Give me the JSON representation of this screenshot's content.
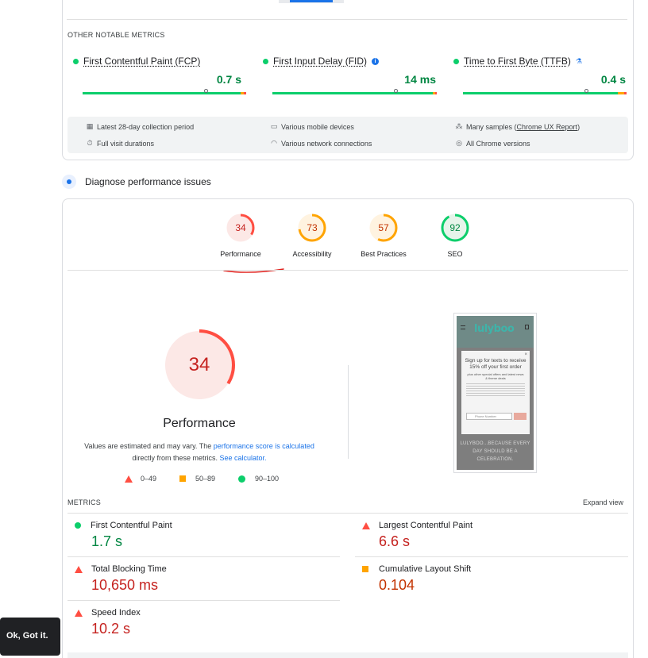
{
  "field_data": {
    "section_label": "OTHER NOTABLE METRICS",
    "metrics": [
      {
        "label": "First Contentful Paint (FCP)",
        "value": "0.7 s",
        "status": "good",
        "icon": "",
        "marker_fraction": 0.75
      },
      {
        "label": "First Input Delay (FID)",
        "value": "14 ms",
        "status": "good",
        "icon": "info-icon",
        "marker_fraction": 0.75
      },
      {
        "label": "Time to First Byte (TTFB)",
        "value": "0.4 s",
        "status": "good",
        "icon": "flask-icon",
        "marker_fraction": 0.75
      }
    ],
    "info": [
      {
        "icon": "calendar-icon",
        "text": "Latest 28-day collection period"
      },
      {
        "icon": "devices-icon",
        "text": "Various mobile devices"
      },
      {
        "icon": "users-icon",
        "text": "Many samples (",
        "link": "Chrome UX Report",
        "suffix": ")"
      },
      {
        "icon": "timer-icon",
        "text": "Full visit durations"
      },
      {
        "icon": "wifi-icon",
        "text": "Various network connections"
      },
      {
        "icon": "chrome-icon",
        "text": "All Chrome versions"
      }
    ]
  },
  "diagnose": {
    "title": "Diagnose performance issues"
  },
  "category_tabs": [
    {
      "label": "Performance",
      "score": 34,
      "color": "#ff4e42",
      "text_color": "#c5221f",
      "bg": "#fce8e6"
    },
    {
      "label": "Accessibility",
      "score": 73,
      "color": "#ffa400",
      "text_color": "#c33300",
      "bg": "#fff3e0"
    },
    {
      "label": "Best Practices",
      "score": 57,
      "color": "#ffa400",
      "text_color": "#c33300",
      "bg": "#fff3e0"
    },
    {
      "label": "SEO",
      "score": 92,
      "color": "#0cce6b",
      "text_color": "#018642",
      "bg": "#e6f4ea"
    }
  ],
  "main_score": {
    "score": "34",
    "label": "Performance",
    "estimate_text": "Values are estimated and may vary. The ",
    "estimate_link": "performance score is calculated",
    "estimate_text2": " directly from these metrics. ",
    "calc_link": "See calculator."
  },
  "legend": {
    "fail": "0–49",
    "average": "50–89",
    "pass": "90–100"
  },
  "screenshot": {
    "logo": "lulyboo",
    "popup_title": "Sign up for texts to receive 15% off your first order",
    "popup_sub": "plus other special offers and latest news & theme deals",
    "field_placeholder": "Phone Number",
    "bottom_text": "LULYBOO...BECAUSE EVERY DAY SHOULD BE A CELEBRATION."
  },
  "metrics_section": {
    "label": "METRICS",
    "expand": "Expand view",
    "items": [
      {
        "name": "First Contentful Paint",
        "value": "1.7 s",
        "status": "pass"
      },
      {
        "name": "Largest Contentful Paint",
        "value": "6.6 s",
        "status": "fail"
      },
      {
        "name": "Total Blocking Time",
        "value": "10,650 ms",
        "status": "fail"
      },
      {
        "name": "Cumulative Layout Shift",
        "value": "0.104",
        "status": "average"
      },
      {
        "name": "Speed Index",
        "value": "10.2 s",
        "status": "fail"
      }
    ]
  },
  "toast": {
    "label": "Ok, Got it."
  }
}
